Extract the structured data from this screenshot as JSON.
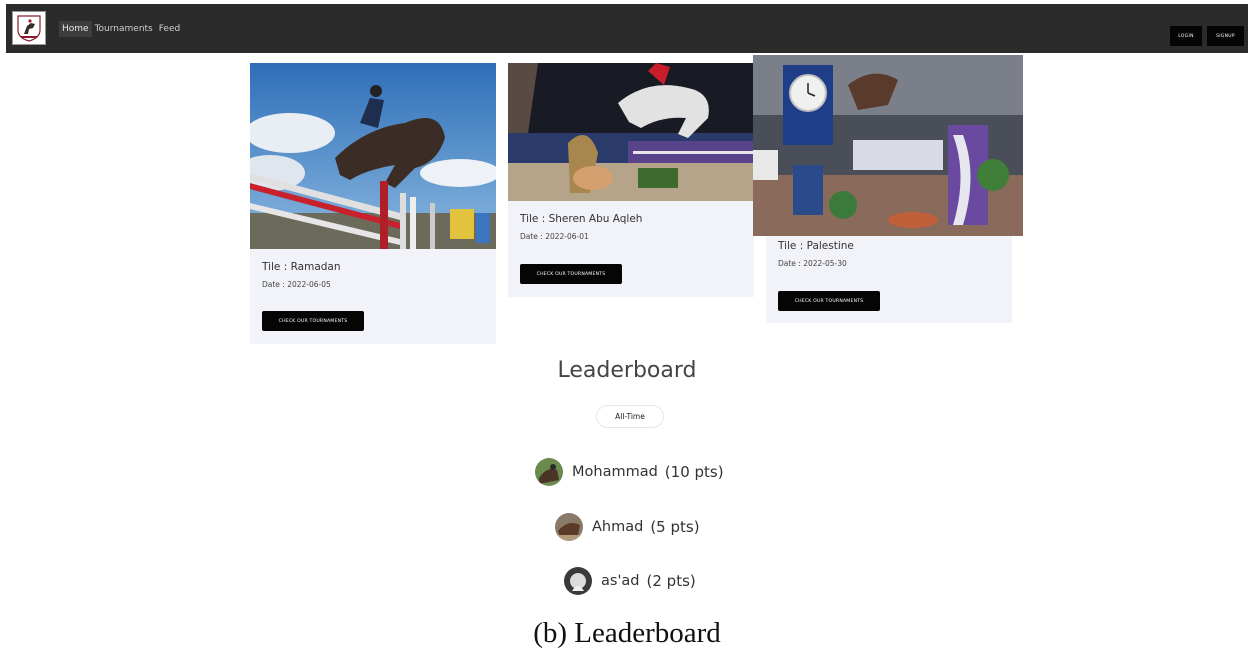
{
  "nav": {
    "links": [
      "Home",
      "Tournaments",
      "Feed"
    ],
    "login": "LOGIN",
    "signup": "SIGNUP"
  },
  "cards": [
    {
      "title": "Tile : Ramadan",
      "date": "Date : 2022-06-05",
      "button": "CHECK OUR TOURNAMENTS"
    },
    {
      "title": "Tile : Sheren Abu Aqleh",
      "date": "Date : 2022-06-01",
      "button": "CHECK OUR TOURNAMENTS"
    },
    {
      "title": "Tile : Palestine",
      "date": "Date : 2022-05-30",
      "button": "CHECK OUR TOURNAMENTS"
    }
  ],
  "leaderboard": {
    "title": "Leaderboard",
    "filter": "All-Time",
    "entries": [
      {
        "name": "Mohammad",
        "points": "(10 pts)"
      },
      {
        "name": "Ahmad",
        "points": "(5 pts)"
      },
      {
        "name": "as'ad",
        "points": "(2 pts)"
      }
    ]
  },
  "caption": "(b) Leaderboard"
}
